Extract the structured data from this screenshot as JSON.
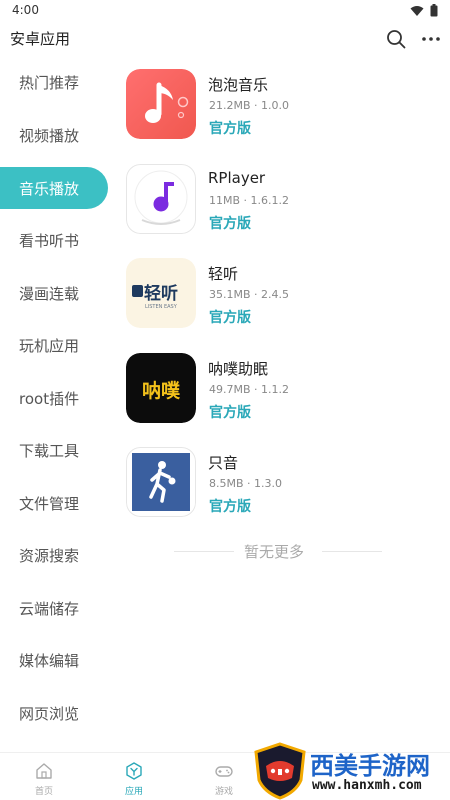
{
  "status_bar": {
    "time": "4:00"
  },
  "header": {
    "title": "安卓应用"
  },
  "sidebar": {
    "items": [
      {
        "label": "热门推荐"
      },
      {
        "label": "视频播放"
      },
      {
        "label": "音乐播放"
      },
      {
        "label": "看书听书"
      },
      {
        "label": "漫画连载"
      },
      {
        "label": "玩机应用"
      },
      {
        "label": "root插件"
      },
      {
        "label": "下载工具"
      },
      {
        "label": "文件管理"
      },
      {
        "label": "资源搜索"
      },
      {
        "label": "云端储存"
      },
      {
        "label": "媒体编辑"
      },
      {
        "label": "网页浏览"
      }
    ],
    "active_index": 2
  },
  "apps": [
    {
      "name": "泡泡音乐",
      "meta": "21.2MB · 1.0.0",
      "badge": "官方版",
      "icon": "music-note-icon"
    },
    {
      "name": "RPlayer",
      "meta": "11MB · 1.6.1.2",
      "badge": "官方版",
      "icon": "music-disc-icon"
    },
    {
      "name": "轻听",
      "meta": "35.1MB · 2.4.5",
      "badge": "官方版",
      "icon_text": "轻听",
      "icon_subtext": "LISTEN EASY",
      "icon": "qingting-logo-icon"
    },
    {
      "name": "呐噗助眠",
      "meta": "49.7MB · 1.1.2",
      "badge": "官方版",
      "icon_text": "呐噗",
      "icon": "napu-logo-icon"
    },
    {
      "name": "只音",
      "meta": "8.5MB · 1.3.0",
      "badge": "官方版",
      "icon": "basketball-player-icon"
    }
  ],
  "no_more": "暂无更多",
  "bottom_nav": [
    {
      "label": "首页",
      "icon": "home-icon"
    },
    {
      "label": "应用",
      "icon": "apps-icon",
      "active": true
    },
    {
      "label": "游戏",
      "icon": "gamepad-icon"
    }
  ],
  "watermark": {
    "title": "西美手游网",
    "url": "www.hanxmh.com"
  },
  "colors": {
    "accent": "#3cc0c4",
    "badge": "#2aa8b8",
    "watermark_blue": "#1e64c8"
  }
}
